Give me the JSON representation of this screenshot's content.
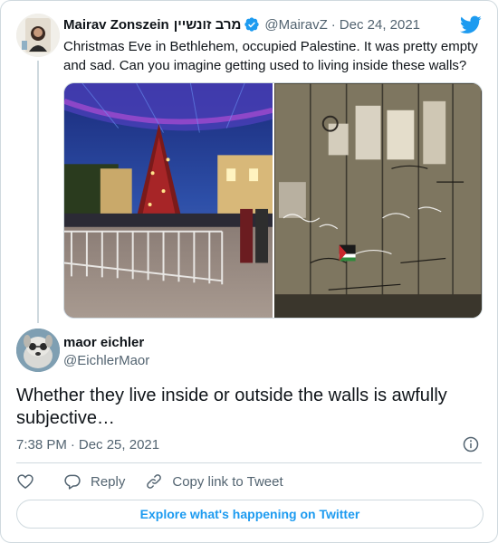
{
  "quoted_tweet": {
    "author_name": "Mairav Zonszein",
    "author_name_hebrew": "מרב זונשיין",
    "verified": true,
    "handle": "@MairavZ",
    "separator": "·",
    "date": "Dec 24, 2021",
    "text": "Christmas Eve in Bethlehem, occupied Palestine. It was pretty empty and sad. Can you imagine getting used to living inside these walls?",
    "avatar_icon": "profile-photo-icon",
    "media": [
      {
        "icon": "christmas-tree-photo"
      },
      {
        "icon": "separation-wall-photo"
      }
    ]
  },
  "reply_tweet": {
    "author_name": "maor eichler",
    "handle": "@EichlerMaor",
    "text": "Whether they live inside or outside the walls is awfully subjective…",
    "time": "7:38 PM",
    "separator": "·",
    "date": "Dec 25, 2021",
    "avatar_icon": "dog-photo-icon"
  },
  "actions": {
    "like_icon": "heart-icon",
    "reply_label": "Reply",
    "reply_icon": "reply-icon",
    "copy_link_label": "Copy link to Tweet",
    "copy_link_icon": "link-icon"
  },
  "explore_button": "Explore what's happening on Twitter",
  "colors": {
    "twitter_blue": "#1d9bf0",
    "text_primary": "#0f1419",
    "text_secondary": "#536471",
    "border": "#cfd9de"
  }
}
